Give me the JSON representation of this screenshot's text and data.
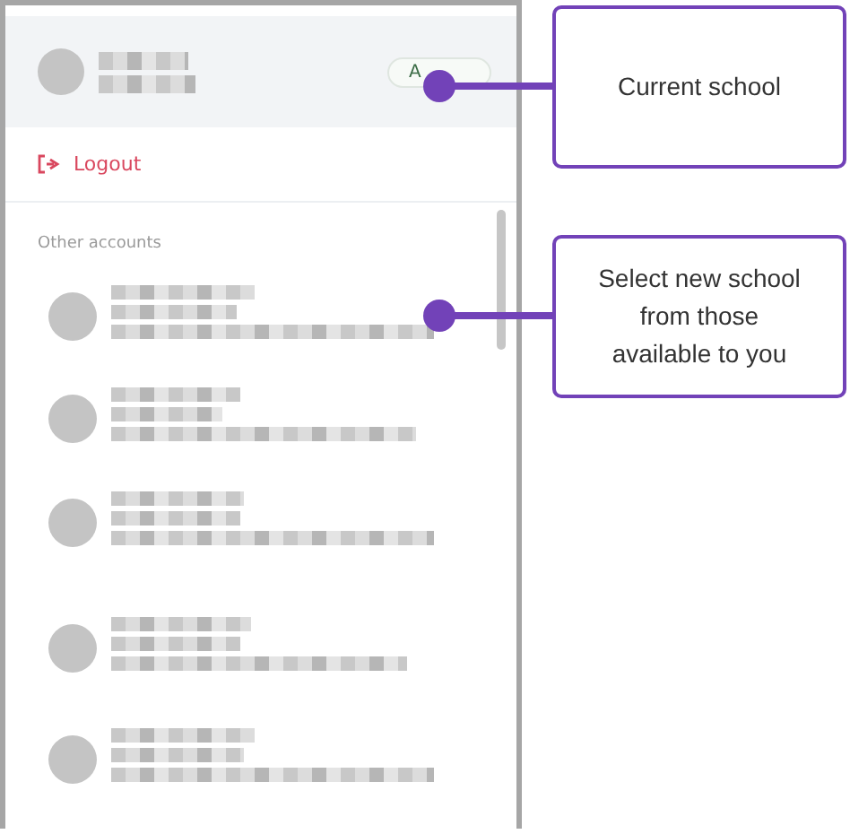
{
  "current_account": {
    "badge": "A"
  },
  "logout": {
    "label": "Logout"
  },
  "other_accounts": {
    "heading": "Other accounts",
    "accounts": [
      {
        "kind": "blurred"
      },
      {
        "kind": "blurred"
      },
      {
        "kind": "blurred"
      },
      {
        "kind": "blurred"
      },
      {
        "kind": "blurred"
      }
    ]
  },
  "callouts": [
    {
      "text": "Current school"
    },
    {
      "text": "Select new school from those available to you"
    }
  ]
}
